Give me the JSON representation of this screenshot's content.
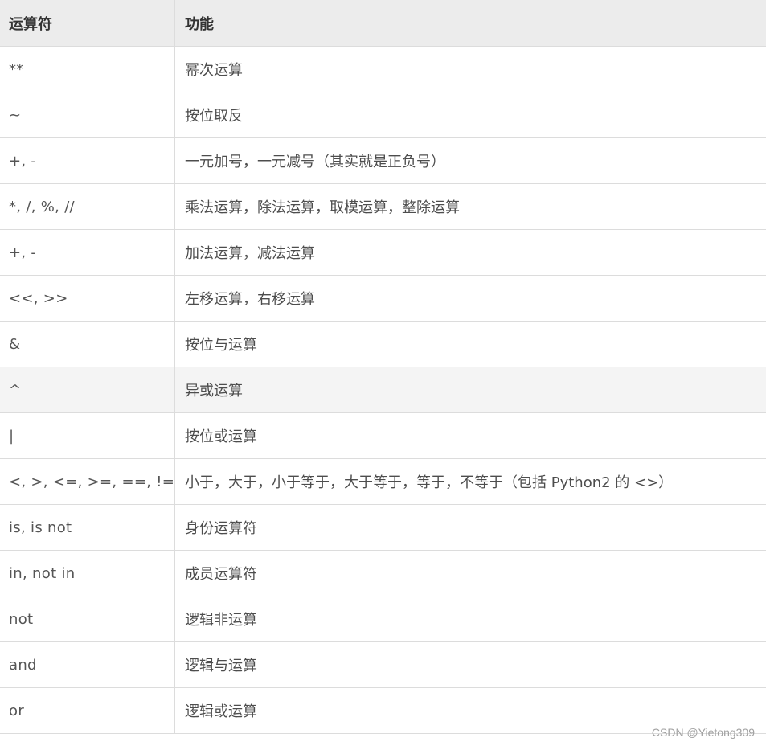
{
  "table": {
    "headers": [
      "运算符",
      "功能"
    ],
    "rows": [
      {
        "op": "**",
        "func": "幂次运算"
      },
      {
        "op": "~",
        "func": "按位取反"
      },
      {
        "op": "+, -",
        "func": "一元加号，一元减号（其实就是正负号）"
      },
      {
        "op": "*, /, %, //",
        "func": "乘法运算，除法运算，取模运算，整除运算"
      },
      {
        "op": "+, -",
        "func": "加法运算，减法运算"
      },
      {
        "op": "<<, >>",
        "func": "左移运算，右移运算"
      },
      {
        "op": "&",
        "func": "按位与运算"
      },
      {
        "op": "^",
        "func": "异或运算"
      },
      {
        "op": "|",
        "func": "按位或运算"
      },
      {
        "op": "<, >, <=, >=, ==, !=",
        "func": "小于，大于，小于等于，大于等于，等于，不等于（包括 Python2 的 <>）"
      },
      {
        "op": "is, is not",
        "func": "身份运算符"
      },
      {
        "op": "in, not in",
        "func": "成员运算符"
      },
      {
        "op": "not",
        "func": "逻辑非运算"
      },
      {
        "op": "and",
        "func": "逻辑与运算"
      },
      {
        "op": "or",
        "func": "逻辑或运算"
      }
    ]
  },
  "watermark": "CSDN @Yietong309"
}
